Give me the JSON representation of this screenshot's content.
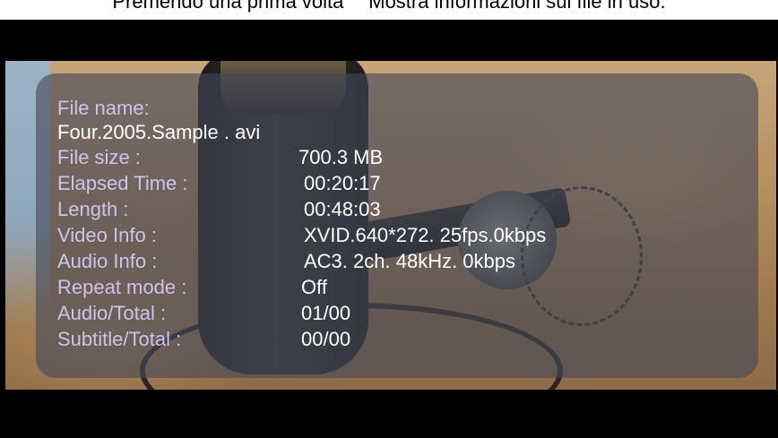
{
  "caption": "Premendo una prima volta \"\" Mostra informazioni sul file in uso.",
  "info": {
    "file_name_label": "File name:",
    "file_name_value": "Four.2005.Sample . avi",
    "rows": [
      {
        "label": "File size :",
        "value": "700.3 MB"
      },
      {
        "label": "Elapsed Time :",
        "value": "00:20:17"
      },
      {
        "label": "Length :",
        "value": "00:48:03"
      },
      {
        "label": "Video Info :",
        "value": "XVID.640*272. 25fps.0kbps"
      },
      {
        "label": "Audio Info :",
        "value": "AC3. 2ch. 48kHz. 0kbps"
      },
      {
        "label": "Repeat mode :",
        "value": "Off"
      },
      {
        "label": "Audio/Total :",
        "value": "01/00"
      },
      {
        "label": "Subtitle/Total :",
        "value": "00/00"
      }
    ]
  },
  "colors": {
    "label": "#cfc2ee",
    "value": "#ffffff",
    "panel": "#444858"
  }
}
